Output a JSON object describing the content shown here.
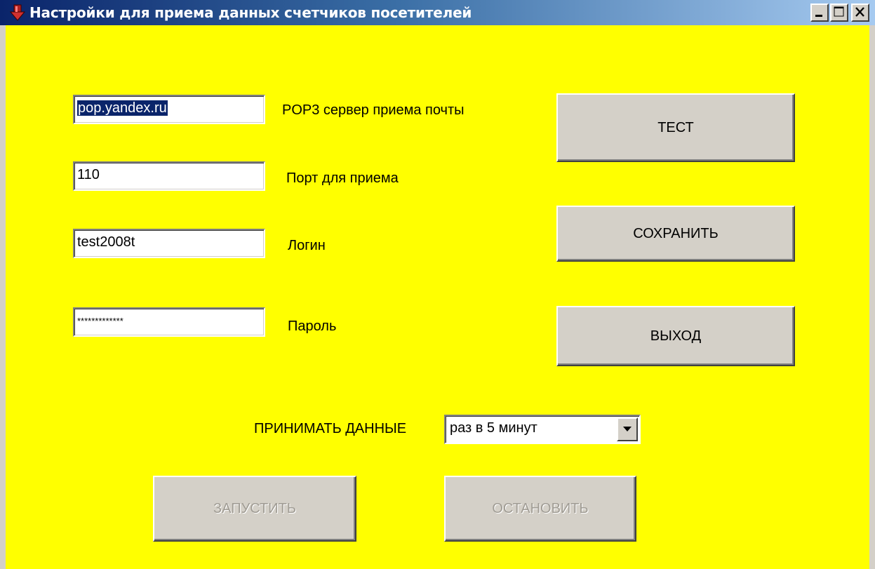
{
  "window": {
    "title": "Настройки для приема данных счетчиков посетителей",
    "controls": [
      "minimize-icon",
      "maximize-icon",
      "close-icon"
    ]
  },
  "colors": {
    "background": "#ffff00",
    "button_face": "#d4d0c8",
    "titlebar_start": "#0a246a",
    "titlebar_end": "#a6caf0"
  },
  "form": {
    "pop3_server": {
      "value": "pop.yandex.ru",
      "label": "POP3 сервер приема почты"
    },
    "port": {
      "value": "110",
      "label": "Порт для приема"
    },
    "login": {
      "value": "test2008t",
      "label": "Логин"
    },
    "password": {
      "value": "*************",
      "label": "Пароль"
    }
  },
  "buttons": {
    "test": "ТЕСТ",
    "save": "СОХРАНИТЬ",
    "exit": "ВЫХОД",
    "start": "ЗАПУСТИТЬ",
    "stop": "ОСТАНОВИТЬ"
  },
  "receive": {
    "label": "ПРИНИМАТЬ ДАННЫЕ",
    "selected": "раз в 5 минут"
  }
}
